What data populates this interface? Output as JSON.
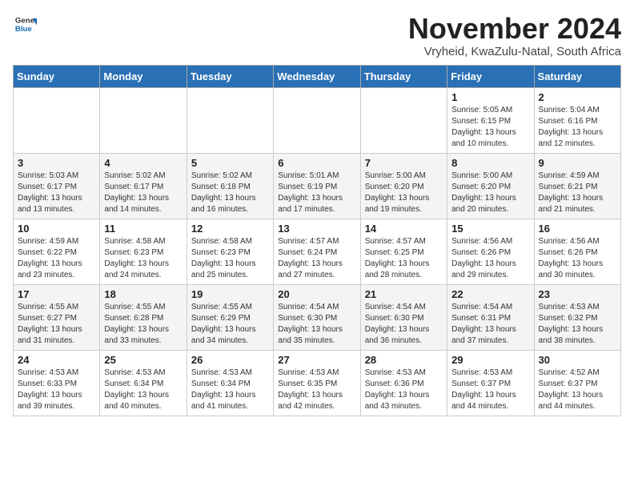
{
  "logo": {
    "general": "General",
    "blue": "Blue"
  },
  "header": {
    "month_title": "November 2024",
    "subtitle": "Vryheid, KwaZulu-Natal, South Africa"
  },
  "days_of_week": [
    "Sunday",
    "Monday",
    "Tuesday",
    "Wednesday",
    "Thursday",
    "Friday",
    "Saturday"
  ],
  "weeks": [
    [
      {
        "day": "",
        "info": ""
      },
      {
        "day": "",
        "info": ""
      },
      {
        "day": "",
        "info": ""
      },
      {
        "day": "",
        "info": ""
      },
      {
        "day": "",
        "info": ""
      },
      {
        "day": "1",
        "info": "Sunrise: 5:05 AM\nSunset: 6:15 PM\nDaylight: 13 hours and 10 minutes."
      },
      {
        "day": "2",
        "info": "Sunrise: 5:04 AM\nSunset: 6:16 PM\nDaylight: 13 hours and 12 minutes."
      }
    ],
    [
      {
        "day": "3",
        "info": "Sunrise: 5:03 AM\nSunset: 6:17 PM\nDaylight: 13 hours and 13 minutes."
      },
      {
        "day": "4",
        "info": "Sunrise: 5:02 AM\nSunset: 6:17 PM\nDaylight: 13 hours and 14 minutes."
      },
      {
        "day": "5",
        "info": "Sunrise: 5:02 AM\nSunset: 6:18 PM\nDaylight: 13 hours and 16 minutes."
      },
      {
        "day": "6",
        "info": "Sunrise: 5:01 AM\nSunset: 6:19 PM\nDaylight: 13 hours and 17 minutes."
      },
      {
        "day": "7",
        "info": "Sunrise: 5:00 AM\nSunset: 6:20 PM\nDaylight: 13 hours and 19 minutes."
      },
      {
        "day": "8",
        "info": "Sunrise: 5:00 AM\nSunset: 6:20 PM\nDaylight: 13 hours and 20 minutes."
      },
      {
        "day": "9",
        "info": "Sunrise: 4:59 AM\nSunset: 6:21 PM\nDaylight: 13 hours and 21 minutes."
      }
    ],
    [
      {
        "day": "10",
        "info": "Sunrise: 4:59 AM\nSunset: 6:22 PM\nDaylight: 13 hours and 23 minutes."
      },
      {
        "day": "11",
        "info": "Sunrise: 4:58 AM\nSunset: 6:23 PM\nDaylight: 13 hours and 24 minutes."
      },
      {
        "day": "12",
        "info": "Sunrise: 4:58 AM\nSunset: 6:23 PM\nDaylight: 13 hours and 25 minutes."
      },
      {
        "day": "13",
        "info": "Sunrise: 4:57 AM\nSunset: 6:24 PM\nDaylight: 13 hours and 27 minutes."
      },
      {
        "day": "14",
        "info": "Sunrise: 4:57 AM\nSunset: 6:25 PM\nDaylight: 13 hours and 28 minutes."
      },
      {
        "day": "15",
        "info": "Sunrise: 4:56 AM\nSunset: 6:26 PM\nDaylight: 13 hours and 29 minutes."
      },
      {
        "day": "16",
        "info": "Sunrise: 4:56 AM\nSunset: 6:26 PM\nDaylight: 13 hours and 30 minutes."
      }
    ],
    [
      {
        "day": "17",
        "info": "Sunrise: 4:55 AM\nSunset: 6:27 PM\nDaylight: 13 hours and 31 minutes."
      },
      {
        "day": "18",
        "info": "Sunrise: 4:55 AM\nSunset: 6:28 PM\nDaylight: 13 hours and 33 minutes."
      },
      {
        "day": "19",
        "info": "Sunrise: 4:55 AM\nSunset: 6:29 PM\nDaylight: 13 hours and 34 minutes."
      },
      {
        "day": "20",
        "info": "Sunrise: 4:54 AM\nSunset: 6:30 PM\nDaylight: 13 hours and 35 minutes."
      },
      {
        "day": "21",
        "info": "Sunrise: 4:54 AM\nSunset: 6:30 PM\nDaylight: 13 hours and 36 minutes."
      },
      {
        "day": "22",
        "info": "Sunrise: 4:54 AM\nSunset: 6:31 PM\nDaylight: 13 hours and 37 minutes."
      },
      {
        "day": "23",
        "info": "Sunrise: 4:53 AM\nSunset: 6:32 PM\nDaylight: 13 hours and 38 minutes."
      }
    ],
    [
      {
        "day": "24",
        "info": "Sunrise: 4:53 AM\nSunset: 6:33 PM\nDaylight: 13 hours and 39 minutes."
      },
      {
        "day": "25",
        "info": "Sunrise: 4:53 AM\nSunset: 6:34 PM\nDaylight: 13 hours and 40 minutes."
      },
      {
        "day": "26",
        "info": "Sunrise: 4:53 AM\nSunset: 6:34 PM\nDaylight: 13 hours and 41 minutes."
      },
      {
        "day": "27",
        "info": "Sunrise: 4:53 AM\nSunset: 6:35 PM\nDaylight: 13 hours and 42 minutes."
      },
      {
        "day": "28",
        "info": "Sunrise: 4:53 AM\nSunset: 6:36 PM\nDaylight: 13 hours and 43 minutes."
      },
      {
        "day": "29",
        "info": "Sunrise: 4:53 AM\nSunset: 6:37 PM\nDaylight: 13 hours and 44 minutes."
      },
      {
        "day": "30",
        "info": "Sunrise: 4:52 AM\nSunset: 6:37 PM\nDaylight: 13 hours and 44 minutes."
      }
    ]
  ]
}
